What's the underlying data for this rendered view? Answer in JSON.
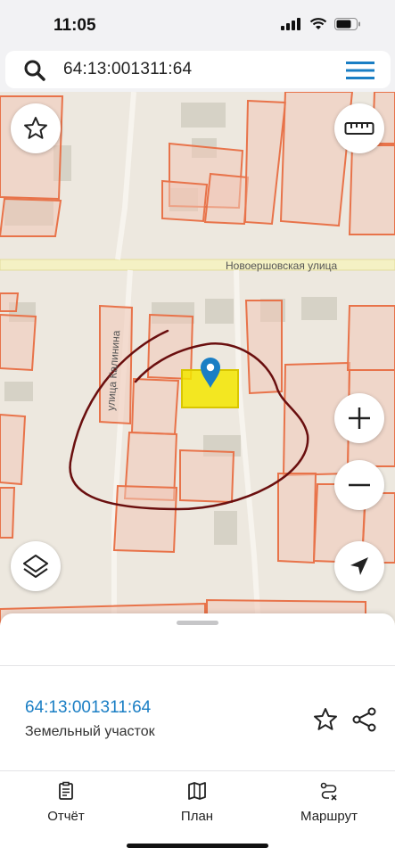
{
  "status": {
    "time": "11:05"
  },
  "search": {
    "value": "64:13:001311:64"
  },
  "map": {
    "street_main": "Новоершовская улица",
    "street_side": "улица Калинина",
    "parcel_color": "#f3e600",
    "parcel_border": "#e8734a",
    "pin_color": "#1a7ec4",
    "annotation_color": "#6a0f0f"
  },
  "controls": {
    "favorite": "star-icon",
    "ruler": "ruler-icon",
    "zoom_in": "plus-icon",
    "zoom_out": "minus-icon",
    "layers": "layers-icon",
    "locate": "location-arrow-icon"
  },
  "card": {
    "cadastral_number": "64:13:001311:64",
    "object_type": "Земельный участок"
  },
  "tabs": [
    {
      "label": "Отчёт",
      "icon": "report-icon"
    },
    {
      "label": "План",
      "icon": "map-icon"
    },
    {
      "label": "Маршрут",
      "icon": "route-icon"
    }
  ]
}
